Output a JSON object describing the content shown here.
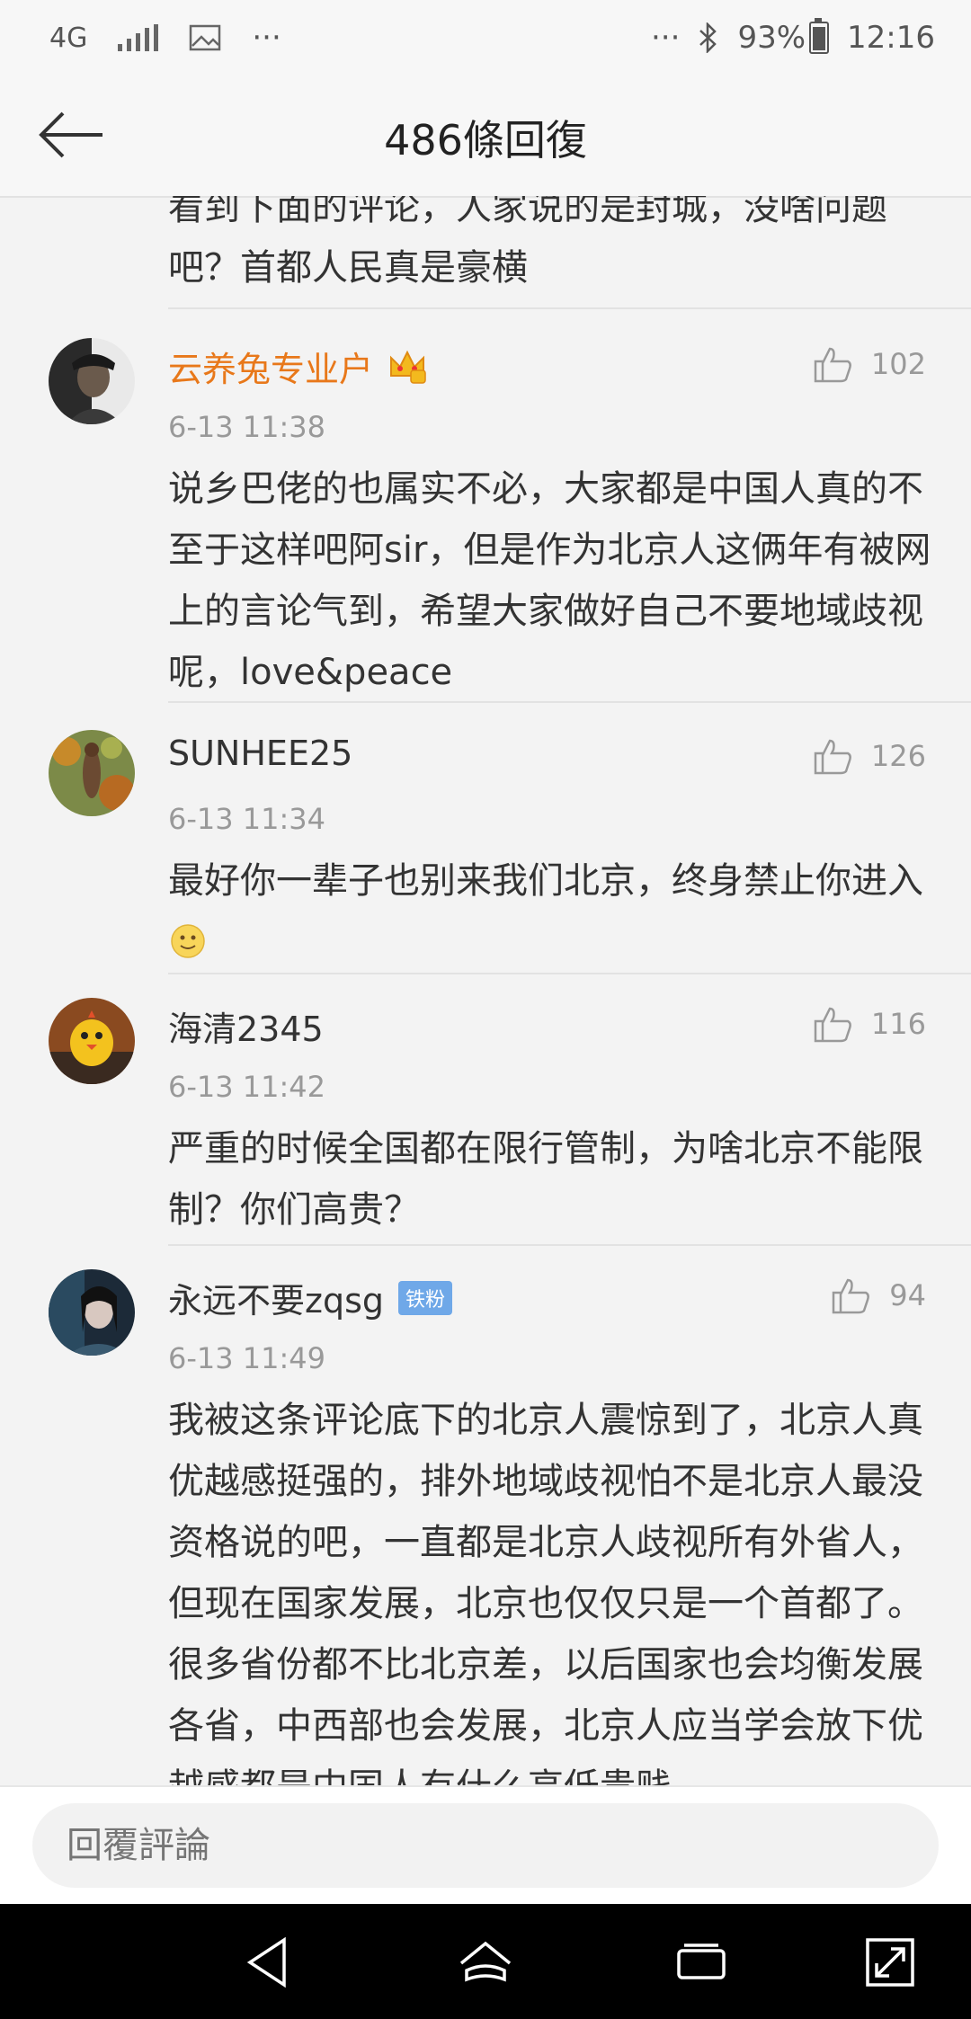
{
  "status_bar": {
    "network": "4G",
    "more": "···",
    "right_more": "···",
    "battery": "93%",
    "time": "12:16"
  },
  "header": {
    "title": "486條回復"
  },
  "partial_comment": {
    "line1": "看到下面的评论，人家说的是封城，没啥问题",
    "line2": "吧？首都人民真是豪横"
  },
  "comments": [
    {
      "username": "云养兔专业户",
      "time": "6-13 11:38",
      "likes": "102",
      "body": "说乡巴佬的也属实不必，大家都是中国人真的不至于这样吧阿sir，但是作为北京人这俩年有被网上的言论气到，希望大家做好自己不要地域歧视呢，love&peace"
    },
    {
      "username": "SUNHEE25",
      "time": "6-13 11:34",
      "likes": "126",
      "body": "最好你一辈子也别来我们北京，终身禁止你进入"
    },
    {
      "username": "海清2345",
      "time": "6-13 11:42",
      "likes": "116",
      "body": "严重的时候全国都在限行管制，为啥北京不能限制？你们高贵？"
    },
    {
      "username": "永远不要zqsg",
      "badge": "铁粉",
      "time": "6-13 11:49",
      "likes": "94",
      "body": "我被这条评论底下的北京人震惊到了，北京人真优越感挺强的，排外地域歧视怕不是北京人最没资格说的吧，一直都是北京人歧视所有外省人，但现在国家发展，北京也仅仅只是一个首都了。很多省份都不比北京差，以后国家也会均衡发展各省，中西部也会发展，北京人应当学会放下优越感都是中国人有什么高低贵贱"
    }
  ],
  "reply_bar": {
    "placeholder": "回覆評論"
  },
  "colors": {
    "vip_name": "#e8781a",
    "fan_badge": "#6fa8e8"
  }
}
